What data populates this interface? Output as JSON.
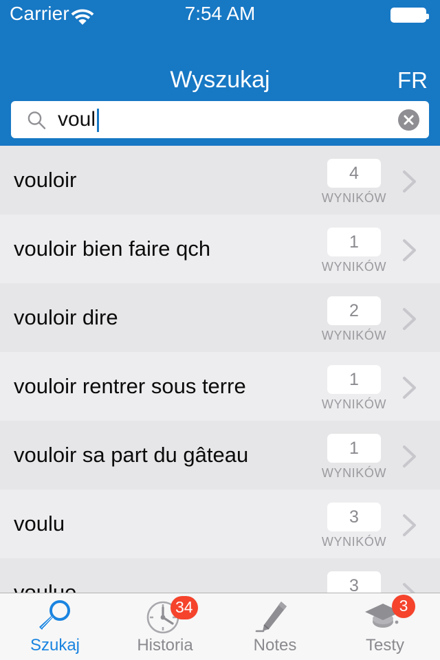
{
  "status_bar": {
    "carrier": "Carrier",
    "time": "7:54 AM",
    "wifi_icon": "wifi-icon",
    "battery_icon": "battery-icon"
  },
  "nav": {
    "title": "Wyszukaj",
    "language_button": "FR"
  },
  "search": {
    "value": "voul",
    "placeholder": "",
    "search_icon": "search-icon",
    "clear_icon": "clear-circle-icon"
  },
  "list": {
    "unit_label": "WYNIKÓW",
    "chevron_icon": "chevron-right-icon",
    "rows": [
      {
        "term": "vouloir",
        "count": "4"
      },
      {
        "term": "vouloir bien faire qch",
        "count": "1"
      },
      {
        "term": "vouloir dire",
        "count": "2"
      },
      {
        "term": "vouloir rentrer sous terre",
        "count": "1"
      },
      {
        "term": "vouloir sa part du gâteau",
        "count": "1"
      },
      {
        "term": "voulu",
        "count": "3"
      },
      {
        "term": "voulue",
        "count": "3"
      }
    ]
  },
  "tabbar": {
    "items": [
      {
        "label": "Szukaj",
        "icon": "magnifier-icon",
        "badge": "",
        "active": true
      },
      {
        "label": "Historia",
        "icon": "clock-icon",
        "badge": "34",
        "active": false
      },
      {
        "label": "Notes",
        "icon": "pen-icon",
        "badge": "",
        "active": false
      },
      {
        "label": "Testy",
        "icon": "graduation-cap-icon",
        "badge": "3",
        "active": false
      }
    ]
  },
  "colors": {
    "accent_blue": "#1778c4",
    "tab_active": "#1a84e0",
    "badge_red": "#f5432c",
    "row_light": "#ededef",
    "row_dark": "#e6e6e8",
    "chevron_gray": "#c7c7cc"
  }
}
